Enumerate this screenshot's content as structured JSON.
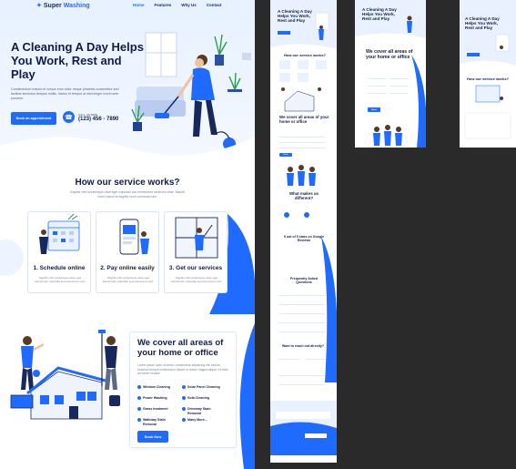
{
  "brand": {
    "name_part1": "Super",
    "name_part2": "Washing",
    "icon": "sparkle-icon"
  },
  "nav": {
    "items": [
      "Home",
      "Features",
      "Why Us",
      "Contact"
    ],
    "active_index": 0
  },
  "hero": {
    "title": "A Cleaning A Day Helps You Work, Rest and Play",
    "subtitle": "Condimentum mauris et cursus eros dolor neque pharetra consectetur sed facilisis senectus tempus mollis. Varius et tempor ut nisi integer morbi ante posuere.",
    "cta_label": "Book an appointment",
    "call_label": "CALL US NOW",
    "phone": "(123) 456 - 7890"
  },
  "services": {
    "title": "How our service works?",
    "description": "Sagittis nibh scelerisque vitae eget vulputate sed elementum senectus vitae. Blandit lorem ipsum at sagittis nunc commodo sed.",
    "steps": [
      {
        "title": "1. Schedule online",
        "text": "Sagittis nibh scelerisque vitae eget elementum vulputate sed elementum sed."
      },
      {
        "title": "2. Pay online easily",
        "text": "Sagittis nibh scelerisque vitae eget elementum vulputate sed elementum sed."
      },
      {
        "title": "3. Get our services",
        "text": "Sagittis nibh scelerisque vitae eget elementum vulputate sed elementum sed."
      }
    ]
  },
  "coverage": {
    "title": "We cover all areas of your home or office",
    "description": "Lorem ipsum dolor sit amet, consectetur adipiscing elit, sed do eiusmod tempor incididunt ut labore et dolore magna aliqua. Ut enim ad minim veniam.",
    "features": [
      "Window Cleaning",
      "Solar Panel Cleaning",
      "Power Washing",
      "Sofa Cleaning",
      "Grass treatment",
      "Driveway Stain Removal",
      "Walkway Stain Removal",
      "Many More..."
    ],
    "cta_label": "Book Now"
  },
  "mobile": {
    "hero_title": "A Cleaning A Day Helps You Work, Rest and Play",
    "services_title": "How our service works?",
    "coverage_title": "We cover all areas of your home or office",
    "why_title": "What makes us different?",
    "reviews_title": "5 out of 5 stars on Google Reviews",
    "faq_title": "Frequently Asked Questions",
    "contact_title": "Want to reach out directly?"
  },
  "colors": {
    "primary": "#1f6bff",
    "navy": "#0f1d4a",
    "background_dark": "#2a2a2a"
  }
}
